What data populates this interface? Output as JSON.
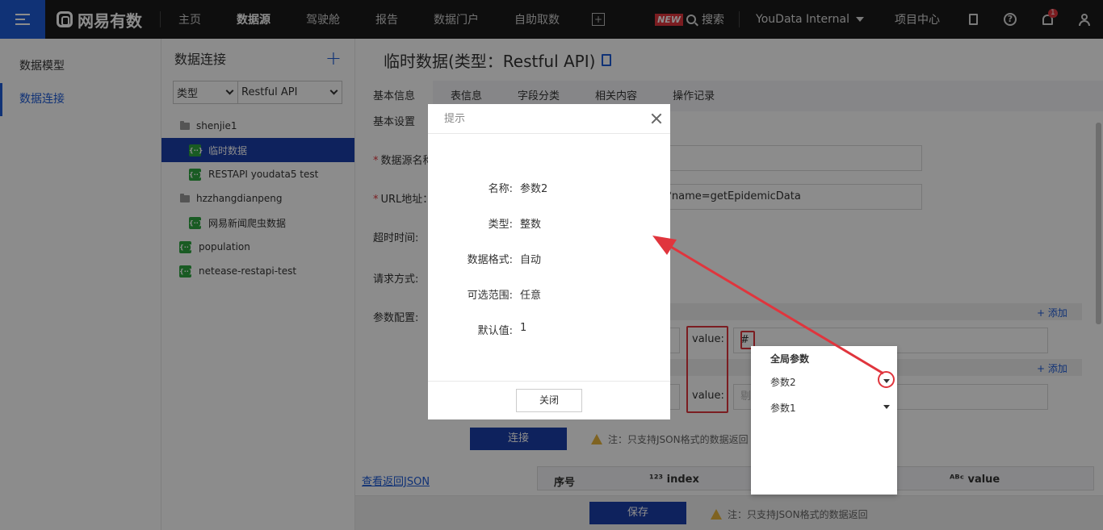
{
  "topbar": {
    "brand": "网易有数",
    "nav": [
      "主页",
      "数据源",
      "驾驶舱",
      "报告",
      "数据门户",
      "自助取数"
    ],
    "active_nav": "数据源",
    "new_badge": "NEW",
    "search": "搜索",
    "org": "YouData Internal",
    "project_center": "项目中心",
    "notification_count": "1"
  },
  "sidebar": {
    "items": [
      "数据模型",
      "数据连接"
    ],
    "active": "数据连接"
  },
  "tree": {
    "title": "数据连接",
    "filter_type": "类型",
    "filter_value": "Restful API",
    "nodes": [
      {
        "label": "shenjie1",
        "kind": "folder"
      },
      {
        "label": "临时数据",
        "kind": "api"
      },
      {
        "label": "RESTAPI youdata5 test",
        "kind": "api"
      },
      {
        "label": "hzzhangdianpeng",
        "kind": "folder"
      },
      {
        "label": "网易新闻爬虫数据",
        "kind": "api"
      },
      {
        "label": "population",
        "kind": "api"
      },
      {
        "label": "netease-restapi-test",
        "kind": "api"
      }
    ],
    "api_icon_text": "{··}"
  },
  "main": {
    "title": "临时数据(类型：Restful API)",
    "tabs": [
      "基本信息",
      "表信息",
      "字段分类",
      "相关内容",
      "操作记录"
    ],
    "active_tab": "基本信息",
    "section": "基本设置",
    "fields": {
      "name_label": "数据源名称：",
      "url_label": "URL地址：",
      "url_value_tail": "?name=getEpidemicData",
      "timeout_label": "超时时间:",
      "method_label": "请求方式:",
      "params_label": "参数配置:",
      "value_label": "value:",
      "value1": "#",
      "value2_placeholder": "剔"
    },
    "add_link": "+ 添加",
    "connect_btn": "连接",
    "note": "注：只支持JSON格式的数据返回",
    "view_json": "查看返回JSON",
    "table_cols": [
      "序号",
      "¹²³ index",
      "ᴬᴮᶜ value"
    ],
    "save_btn": "保存"
  },
  "modal": {
    "title": "提示",
    "rows": [
      {
        "k": "名称:",
        "v": "参数2"
      },
      {
        "k": "类型:",
        "v": "整数"
      },
      {
        "k": "数据格式:",
        "v": "自动"
      },
      {
        "k": "可选范围:",
        "v": "任意"
      },
      {
        "k": "默认值:",
        "v": "1"
      }
    ],
    "close_btn": "关闭"
  },
  "popup": {
    "title": "全局参数",
    "items": [
      "参数2",
      "参数1"
    ]
  },
  "colors": {
    "brand_blue": "#1e5bd8",
    "selected_row": "#1b3fa9",
    "annotation_red": "#e0353d",
    "api_green": "#2ea641"
  }
}
